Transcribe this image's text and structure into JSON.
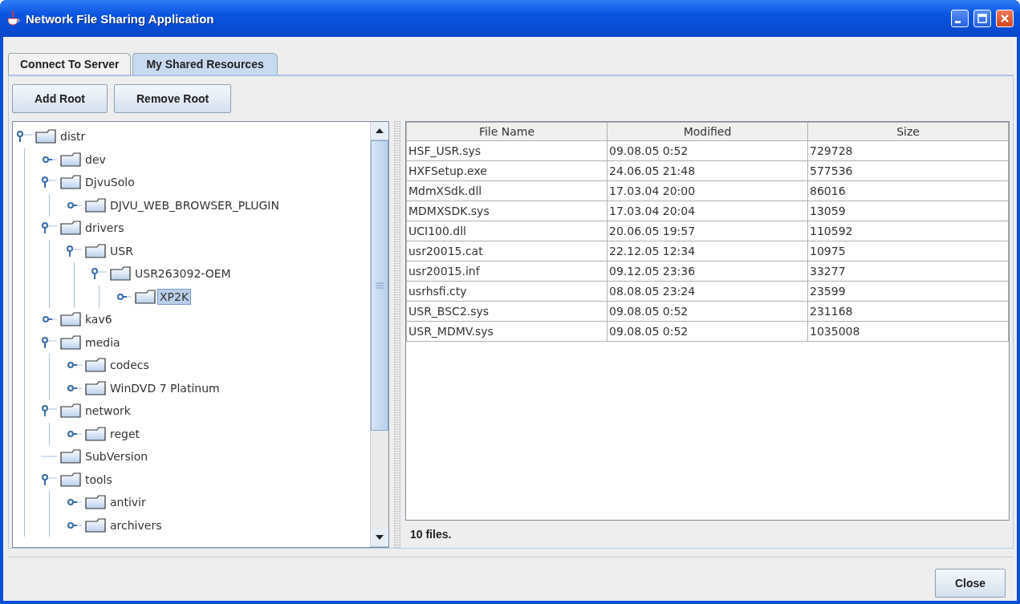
{
  "window": {
    "title": "Network File Sharing Application"
  },
  "tabs": [
    {
      "label": "Connect To Server",
      "selected": false
    },
    {
      "label": "My Shared Resources",
      "selected": true
    }
  ],
  "toolbar": {
    "buttons": [
      "Add Root",
      "Remove Root"
    ]
  },
  "tree": [
    {
      "label": "distr",
      "kind": "branch",
      "expanded": true,
      "selected": false,
      "children": [
        {
          "label": "dev",
          "kind": "branch",
          "expanded": false,
          "selected": false
        },
        {
          "label": "DjvuSolo",
          "kind": "branch",
          "expanded": true,
          "selected": false,
          "children": [
            {
              "label": "DJVU_WEB_BROWSER_PLUGIN",
              "kind": "branch",
              "expanded": false,
              "selected": false
            }
          ]
        },
        {
          "label": "drivers",
          "kind": "branch",
          "expanded": true,
          "selected": false,
          "children": [
            {
              "label": "USR",
              "kind": "branch",
              "expanded": true,
              "selected": false,
              "children": [
                {
                  "label": "USR263092-OEM",
                  "kind": "branch",
                  "expanded": true,
                  "selected": false,
                  "children": [
                    {
                      "label": "XP2K",
                      "kind": "branch",
                      "expanded": false,
                      "selected": true
                    }
                  ]
                }
              ]
            }
          ]
        },
        {
          "label": "kav6",
          "kind": "branch",
          "expanded": false,
          "selected": false
        },
        {
          "label": "media",
          "kind": "branch",
          "expanded": true,
          "selected": false,
          "children": [
            {
              "label": "codecs",
              "kind": "branch",
              "expanded": false,
              "selected": false
            },
            {
              "label": "WinDVD 7 Platinum",
              "kind": "branch",
              "expanded": false,
              "selected": false
            }
          ]
        },
        {
          "label": "network",
          "kind": "branch",
          "expanded": true,
          "selected": false,
          "children": [
            {
              "label": "reget",
              "kind": "branch",
              "expanded": false,
              "selected": false
            }
          ]
        },
        {
          "label": "SubVersion",
          "kind": "leaf",
          "selected": false
        },
        {
          "label": "tools",
          "kind": "branch",
          "expanded": true,
          "selected": false,
          "children": [
            {
              "label": "antivir",
              "kind": "branch",
              "expanded": false,
              "selected": false
            },
            {
              "label": "archivers",
              "kind": "branch",
              "expanded": false,
              "selected": false
            }
          ]
        }
      ]
    }
  ],
  "table": {
    "columns": [
      "File Name",
      "Modified",
      "Size"
    ],
    "rows": [
      [
        "HSF_USR.sys",
        "09.08.05 0:52",
        "729728"
      ],
      [
        "HXFSetup.exe",
        "24.06.05 21:48",
        "577536"
      ],
      [
        "MdmXSdk.dll",
        "17.03.04 20:00",
        "86016"
      ],
      [
        "MDMXSDK.sys",
        "17.03.04 20:04",
        "13059"
      ],
      [
        "UCI100.dll",
        "20.06.05 19:57",
        "110592"
      ],
      [
        "usr20015.cat",
        "22.12.05 12:34",
        "10975"
      ],
      [
        "usr20015.inf",
        "09.12.05 23:36",
        "33277"
      ],
      [
        "usrhsfi.cty",
        "08.08.05 23:24",
        "23599"
      ],
      [
        "USR_BSC2.sys",
        "09.08.05 0:52",
        "231168"
      ],
      [
        "USR_MDMV.sys",
        "09.08.05 0:52",
        "1035008"
      ]
    ]
  },
  "status_bar": "10 files.",
  "footer": {
    "buttons": [
      "Close"
    ]
  }
}
